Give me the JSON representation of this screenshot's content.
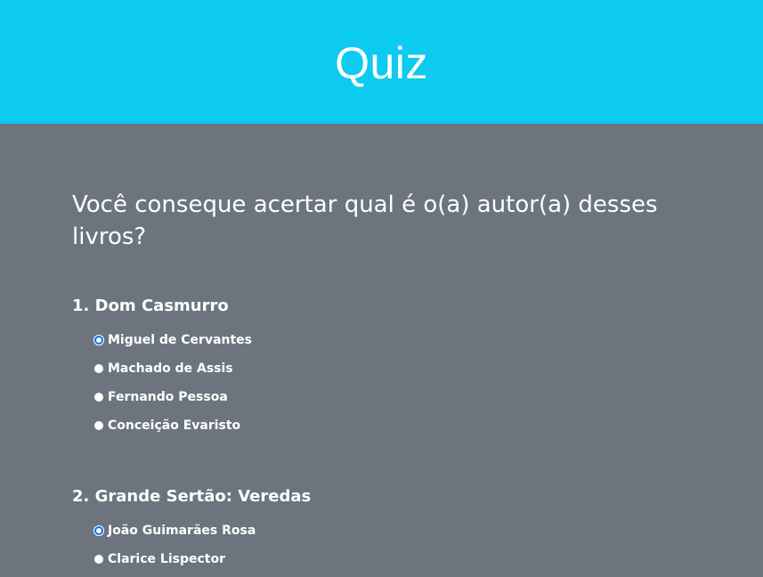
{
  "header": {
    "title": "Quiz"
  },
  "intro": "Você conseque acertar qual é o(a) autor(a) desses livros?",
  "questions": [
    {
      "title": "1. Dom Casmurro",
      "options": [
        {
          "label": "Miguel de Cervantes",
          "checked": true
        },
        {
          "label": "Machado de Assis",
          "checked": false
        },
        {
          "label": "Fernando Pessoa",
          "checked": false
        },
        {
          "label": "Conceição Evaristo",
          "checked": false
        }
      ]
    },
    {
      "title": "2. Grande Sertão: Veredas",
      "options": [
        {
          "label": "João Guimarães Rosa",
          "checked": true
        },
        {
          "label": "Clarice Lispector",
          "checked": false
        }
      ]
    }
  ],
  "colors": {
    "header_bg": "#0dcaf0",
    "page_bg": "#6c757d",
    "radio_accent": "#0d6efd",
    "text": "#ffffff"
  }
}
